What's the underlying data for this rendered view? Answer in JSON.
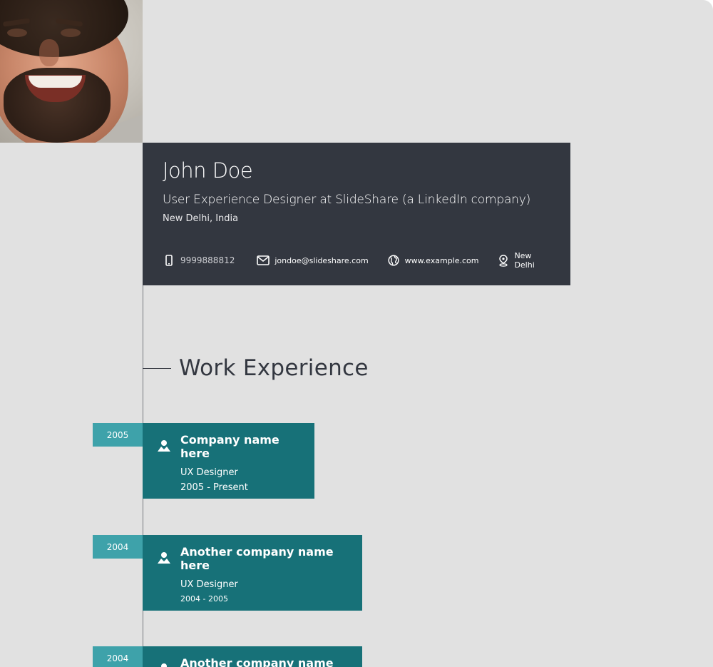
{
  "profile": {
    "name": "John Doe",
    "title": "User Experience Designer at SlideShare (a LinkedIn company)",
    "location": "New Delhi, India",
    "contacts": {
      "phone": "9999888812",
      "email": "jondoe@slideshare.com",
      "website": "www.example.com",
      "city": "New Delhi"
    }
  },
  "work": {
    "heading": "Work Experience",
    "jobs": [
      {
        "year": "2005",
        "company": "Company name here",
        "role": "UX Designer",
        "dates": "2005 - Present"
      },
      {
        "year": "2004",
        "company": "Another company name here",
        "role": "UX Designer",
        "dates": "2004 - 2005"
      },
      {
        "year": "2004",
        "company": "Another company name here",
        "role": "",
        "dates": ""
      }
    ]
  },
  "colors": {
    "background": "#e1e1e1",
    "header": "#333740",
    "card": "#177178",
    "tag": "#3ea2aa"
  },
  "icons": [
    "phone-icon",
    "mail-icon",
    "globe-icon",
    "pin-icon",
    "person-icon"
  ]
}
